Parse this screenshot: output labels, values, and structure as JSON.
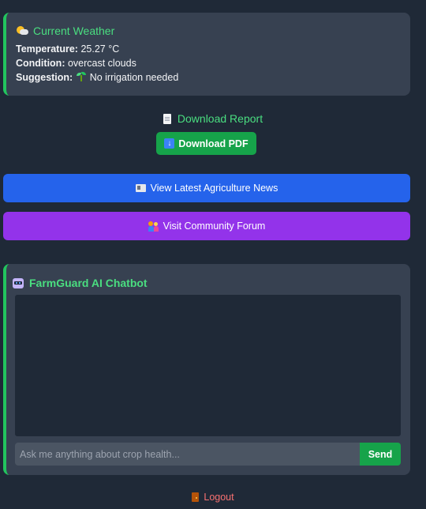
{
  "weather": {
    "title": "Current Weather",
    "title_icon": "sun-behind-cloud-icon",
    "temperature_label": "Temperature:",
    "temperature_value": "25.27 °C",
    "condition_label": "Condition:",
    "condition_value": "overcast clouds",
    "suggestion_label": "Suggestion:",
    "suggestion_icon": "seedling-icon",
    "suggestion_value": "No irrigation needed"
  },
  "report": {
    "heading": "Download Report",
    "heading_icon": "document-icon",
    "download_label": "Download PDF",
    "download_icon": "down-arrow-icon"
  },
  "links": {
    "news_label": "View Latest Agriculture News",
    "news_icon": "newspaper-icon",
    "forum_label": "Visit Community Forum",
    "forum_icon": "people-icon"
  },
  "chatbot": {
    "title": "FarmGuard AI Chatbot",
    "title_icon": "robot-icon",
    "input_placeholder": "Ask me anything about crop health...",
    "input_value": "",
    "send_label": "Send"
  },
  "logout": {
    "label": "Logout",
    "icon": "door-icon"
  },
  "colors": {
    "background": "#1f2937",
    "card": "#374151",
    "accent_green": "#4ade80",
    "button_green": "#16a34a",
    "news_blue": "#2563eb",
    "forum_purple": "#9333ea",
    "logout_red": "#f87171"
  }
}
